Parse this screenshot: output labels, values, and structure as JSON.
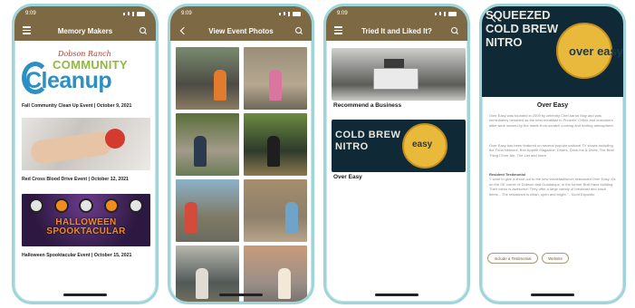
{
  "screen1": {
    "status_time": "9:09",
    "title": "Memory Makers",
    "logo": {
      "top": "Dobson Ranch",
      "community": "COMMUNITY",
      "cleanup": "Cleanup"
    },
    "events": [
      {
        "caption": "Fall Community Clean Up Event | October 9, 2021"
      },
      {
        "caption": "Red Cross Blood Drive Event | October 12, 2021"
      },
      {
        "caption": "Halloween Spooktacular Event | October 15, 2021",
        "image_text": "HALLOWEEN SPOOKTACULAR"
      }
    ]
  },
  "screen2": {
    "status_time": "9:09",
    "title": "View Event Photos"
  },
  "screen3": {
    "status_time": "9:09",
    "title": "Tried It and Liked It?",
    "items": [
      {
        "label": "Recommend a Business"
      },
      {
        "label": "Over Easy"
      }
    ],
    "sign_text": "COLD BREW\nNITRO",
    "logo_word": "easy"
  },
  "screen4": {
    "status_time": "9:09",
    "hero_sign": "SQUEEZED\nCOLD BREW\nNITRO",
    "hero_logo": "over easy",
    "title": "Over Easy",
    "para1": "Over Easy was founded in 2009 by celebrity Chef Aaron May and was immediately heralded as the best breakfast in Phoenix. Critics and customers alike were wowed by the made-from-scratch cooking and inviting atmosphere.",
    "para2": "Over Easy has been featured on several popular national TV shows including the Food Network, Bon Appétit Magazine, Diners, Drive-Ins & Dives, The Best Thing I Ever Ate, The List and more.",
    "testimonial_heading": "Resident Testimonial",
    "testimonial": "\"I want to give a shout out to the new breakfast/lunch restaurant Over Easy. It's on the SE corner of Dobson and Guadalupe, in the former Brat Haus building. Their menu is awesome! They offer a large variety of breakfast and lunch items... The restaurant is clean, open and bright.\" - Scott Esposito",
    "buttons": {
      "testimonial": "Include a Testimonial",
      "website": "Website"
    }
  },
  "icons": [
    "menu-icon",
    "search-icon",
    "back-icon"
  ],
  "colors": {
    "header": "#7d6a45",
    "frame": "#9fd4d8",
    "accent_logo": "#2d8fc4"
  }
}
